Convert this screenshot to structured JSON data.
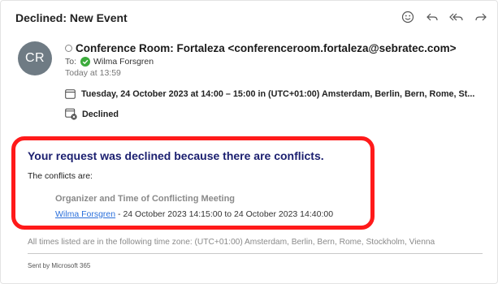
{
  "email": {
    "subject": "Declined: New Event",
    "avatar_initials": "CR",
    "sender": "Conference Room: Fortaleza <conferenceroom.fortaleza@sebratec.com>",
    "to_label": "To:",
    "recipient": "Wilma Forsgren",
    "received": "Today at 13:59",
    "meeting_time": "Tuesday, 24 October 2023 at 14:00 – 15:00 in (UTC+01:00) Amsterdam, Berlin, Bern, Rome, St...",
    "status": "Declined"
  },
  "actions": [
    {
      "name": "emoji-reaction-icon"
    },
    {
      "name": "reply-icon"
    },
    {
      "name": "reply-all-icon"
    },
    {
      "name": "forward-icon"
    }
  ],
  "body": {
    "heading": "Your request was declined because there are conflicts.",
    "intro": "The conflicts are:",
    "conflict_title": "Organizer and Time of Conflicting Meeting",
    "conflict_organizer": "Wilma Forsgren",
    "conflict_time": " - 24 October 2023 14:15:00 to 24 October 2023 14:40:00",
    "timezone_note": "All times listed are in the following time zone: (UTC+01:00) Amsterdam, Berlin, Bern, Rome, Stockholm, Vienna",
    "sent_by": "Sent by Microsoft 365"
  },
  "colors": {
    "highlight_border": "#ff1a1a",
    "heading": "#1c2070",
    "link": "#2a6fdb",
    "avatar": "#6f7b84",
    "check_green": "#3cab3c"
  }
}
